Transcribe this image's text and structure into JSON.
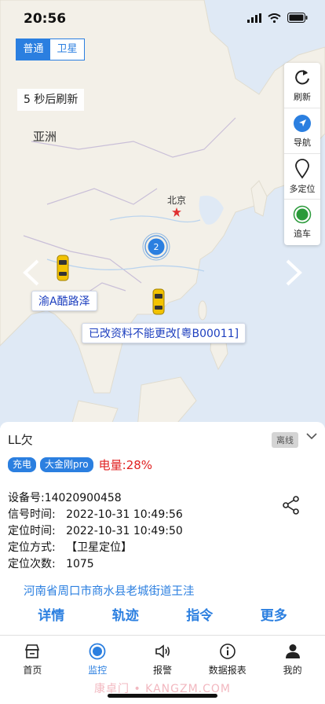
{
  "status": {
    "time": "20:56"
  },
  "map": {
    "type_options": [
      "普通",
      "卫星"
    ],
    "refresh_tip": "5 秒后刷新",
    "labels": {
      "continent": "亚洲",
      "capital": "北京"
    },
    "cluster_count": "2",
    "vehicles": [
      {
        "label": "渝A酷路泽"
      },
      {
        "label": "已改资料不能更改[粤B00011]"
      }
    ]
  },
  "tools": [
    {
      "label": "刷新",
      "icon": "refresh-icon"
    },
    {
      "label": "导航",
      "icon": "navigate-icon"
    },
    {
      "label": "多定位",
      "icon": "location-pin-icon"
    },
    {
      "label": "追车",
      "icon": "track-car-icon"
    }
  ],
  "device": {
    "name": "LL欠",
    "status": "离线",
    "tags": [
      "充电",
      "大金刚pro"
    ],
    "battery": "电量:28%",
    "info_lines": [
      "设备号:14020900458",
      "信号时间:   2022-10-31 10:49:56",
      "定位时间:   2022-10-31 10:49:50",
      "定位方式:   【卫星定位】",
      "定位次数:   1075"
    ],
    "address": "河南省周口市商水县老城街道王洼",
    "actions": [
      "详情",
      "轨迹",
      "指令",
      "更多"
    ]
  },
  "tabbar": [
    {
      "label": "首页",
      "icon": "home-icon"
    },
    {
      "label": "监控",
      "icon": "monitor-icon"
    },
    {
      "label": "报警",
      "icon": "alarm-speaker-icon"
    },
    {
      "label": "数据报表",
      "icon": "info-icon"
    },
    {
      "label": "我的",
      "icon": "user-icon"
    }
  ],
  "watermark": "康卓门 • KANGZM.COM",
  "colors": {
    "accent": "#2b7fe0",
    "battery": "#e02020",
    "vehicle": "#f2c200",
    "offline_badge": "#d4d4d4"
  }
}
